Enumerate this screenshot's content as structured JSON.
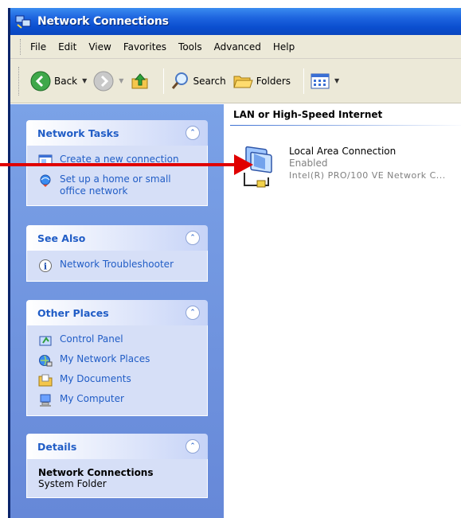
{
  "window": {
    "title": "Network Connections"
  },
  "menubar": {
    "items": [
      "File",
      "Edit",
      "View",
      "Favorites",
      "Tools",
      "Advanced",
      "Help"
    ]
  },
  "toolbar": {
    "back_label": "Back",
    "search_label": "Search",
    "folders_label": "Folders"
  },
  "sidebar": {
    "network_tasks": {
      "title": "Network Tasks",
      "items": [
        "Create a new connection",
        "Set up a home or small office network"
      ]
    },
    "see_also": {
      "title": "See Also",
      "items": [
        "Network Troubleshooter"
      ]
    },
    "other_places": {
      "title": "Other Places",
      "items": [
        "Control Panel",
        "My Network Places",
        "My Documents",
        "My Computer"
      ]
    },
    "details": {
      "title": "Details",
      "name": "Network Connections",
      "type": "System Folder"
    }
  },
  "content": {
    "group_header": "LAN or High-Speed Internet",
    "connection": {
      "name": "Local Area Connection",
      "status": "Enabled",
      "device": "Intel(R) PRO/100 VE Network C..."
    }
  },
  "colors": {
    "title_bar": "#0b4fd0",
    "sidebar": "#6f94dd",
    "link": "#215dc6",
    "arrow": "#e00000"
  }
}
